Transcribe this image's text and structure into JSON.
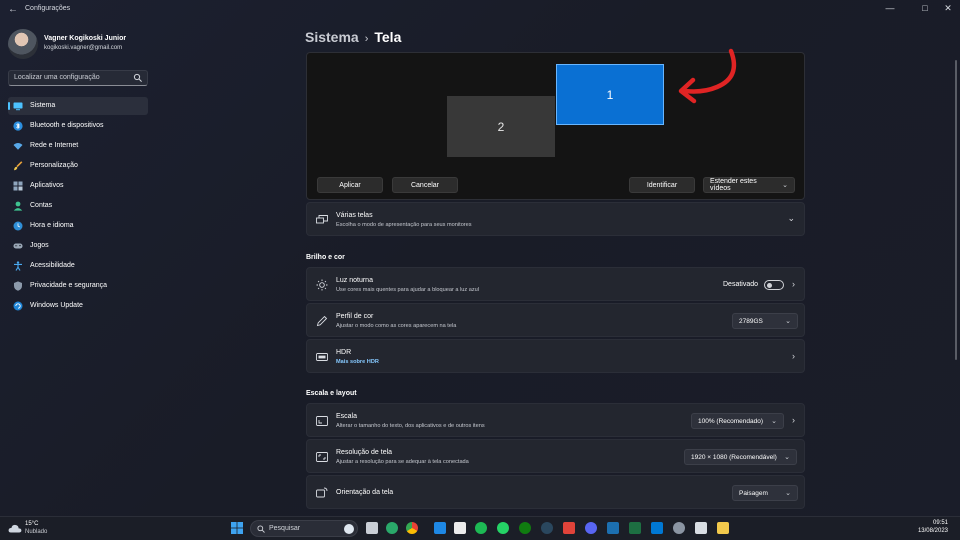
{
  "window": {
    "title": "Configurações",
    "back_icon": "back-arrow-icon",
    "minimize": "—",
    "maximize": "□",
    "close": "✕"
  },
  "profile": {
    "name": "Vagner Kogikoski Junior",
    "email": "kogikoski.vagner@gmail.com"
  },
  "search": {
    "placeholder": "Localizar uma configuração"
  },
  "sidebar": {
    "items": [
      {
        "label": "Sistema",
        "icon": "monitor-icon",
        "active": true
      },
      {
        "label": "Bluetooth e dispositivos",
        "icon": "bluetooth-icon"
      },
      {
        "label": "Rede e Internet",
        "icon": "wifi-icon"
      },
      {
        "label": "Personalização",
        "icon": "brush-icon"
      },
      {
        "label": "Aplicativos",
        "icon": "apps-icon"
      },
      {
        "label": "Contas",
        "icon": "person-icon"
      },
      {
        "label": "Hora e idioma",
        "icon": "globe-clock-icon"
      },
      {
        "label": "Jogos",
        "icon": "gamepad-icon"
      },
      {
        "label": "Acessibilidade",
        "icon": "accessibility-icon"
      },
      {
        "label": "Privacidade e segurança",
        "icon": "shield-icon"
      },
      {
        "label": "Windows Update",
        "icon": "windows-update-icon"
      }
    ]
  },
  "breadcrumb": {
    "parent": "Sistema",
    "separator": "›",
    "current": "Tela"
  },
  "display_arrangement": {
    "monitor_1": "1",
    "monitor_2": "2",
    "apply_label": "Aplicar",
    "cancel_label": "Cancelar",
    "identify_label": "Identificar",
    "extend_label": "Estender estes vídeos",
    "chevron": "⌄"
  },
  "multiple_displays": {
    "title": "Várias telas",
    "subtitle": "Escolha o modo de apresentação para seus monitores"
  },
  "brightness_section": {
    "heading": "Brilho e cor",
    "night_light": {
      "title": "Luz noturna",
      "subtitle": "Use cores mais quentes para ajudar a bloquear a luz azul",
      "state": "Desativado",
      "enabled": false
    },
    "color_profile": {
      "title": "Perfil de cor",
      "subtitle": "Ajustar o modo como as cores aparecem na tela",
      "value": "2789GS"
    },
    "hdr": {
      "title": "HDR",
      "link": "Mais sobre HDR"
    }
  },
  "scale_section": {
    "heading": "Escala e layout",
    "scale": {
      "title": "Escala",
      "subtitle": "Alterar o tamanho do texto, dos aplicativos e de outros itens",
      "value": "100% (Recomendado)"
    },
    "resolution": {
      "title": "Resolução de tela",
      "subtitle": "Ajustar a resolução para se adequar à tela conectada",
      "value": "1920 × 1080 (Recomendável)"
    },
    "orientation": {
      "title": "Orientação da tela",
      "value": "Paisagem"
    }
  },
  "taskbar": {
    "weather_temp": "15°C",
    "weather_condition": "Nublado",
    "search_label": "Pesquisar",
    "time": "09:51",
    "date": "13/08/2023",
    "apps": [
      "copilot-icon",
      "file-explorer-icon",
      "edge-icon",
      "chrome-icon",
      "vscode-icon",
      "notion-icon",
      "spotify-icon",
      "whatsapp-icon",
      "xbox-icon",
      "steam-icon",
      "game-icon",
      "discord-icon",
      "kanban-icon",
      "excel-icon",
      "vscode-blue-icon",
      "settings-icon",
      "snipping-icon",
      "folder-icon"
    ]
  },
  "colors": {
    "accent": "#4cc2ff",
    "monitor_selected": "#0a70d3",
    "arrow": "#e02424"
  }
}
